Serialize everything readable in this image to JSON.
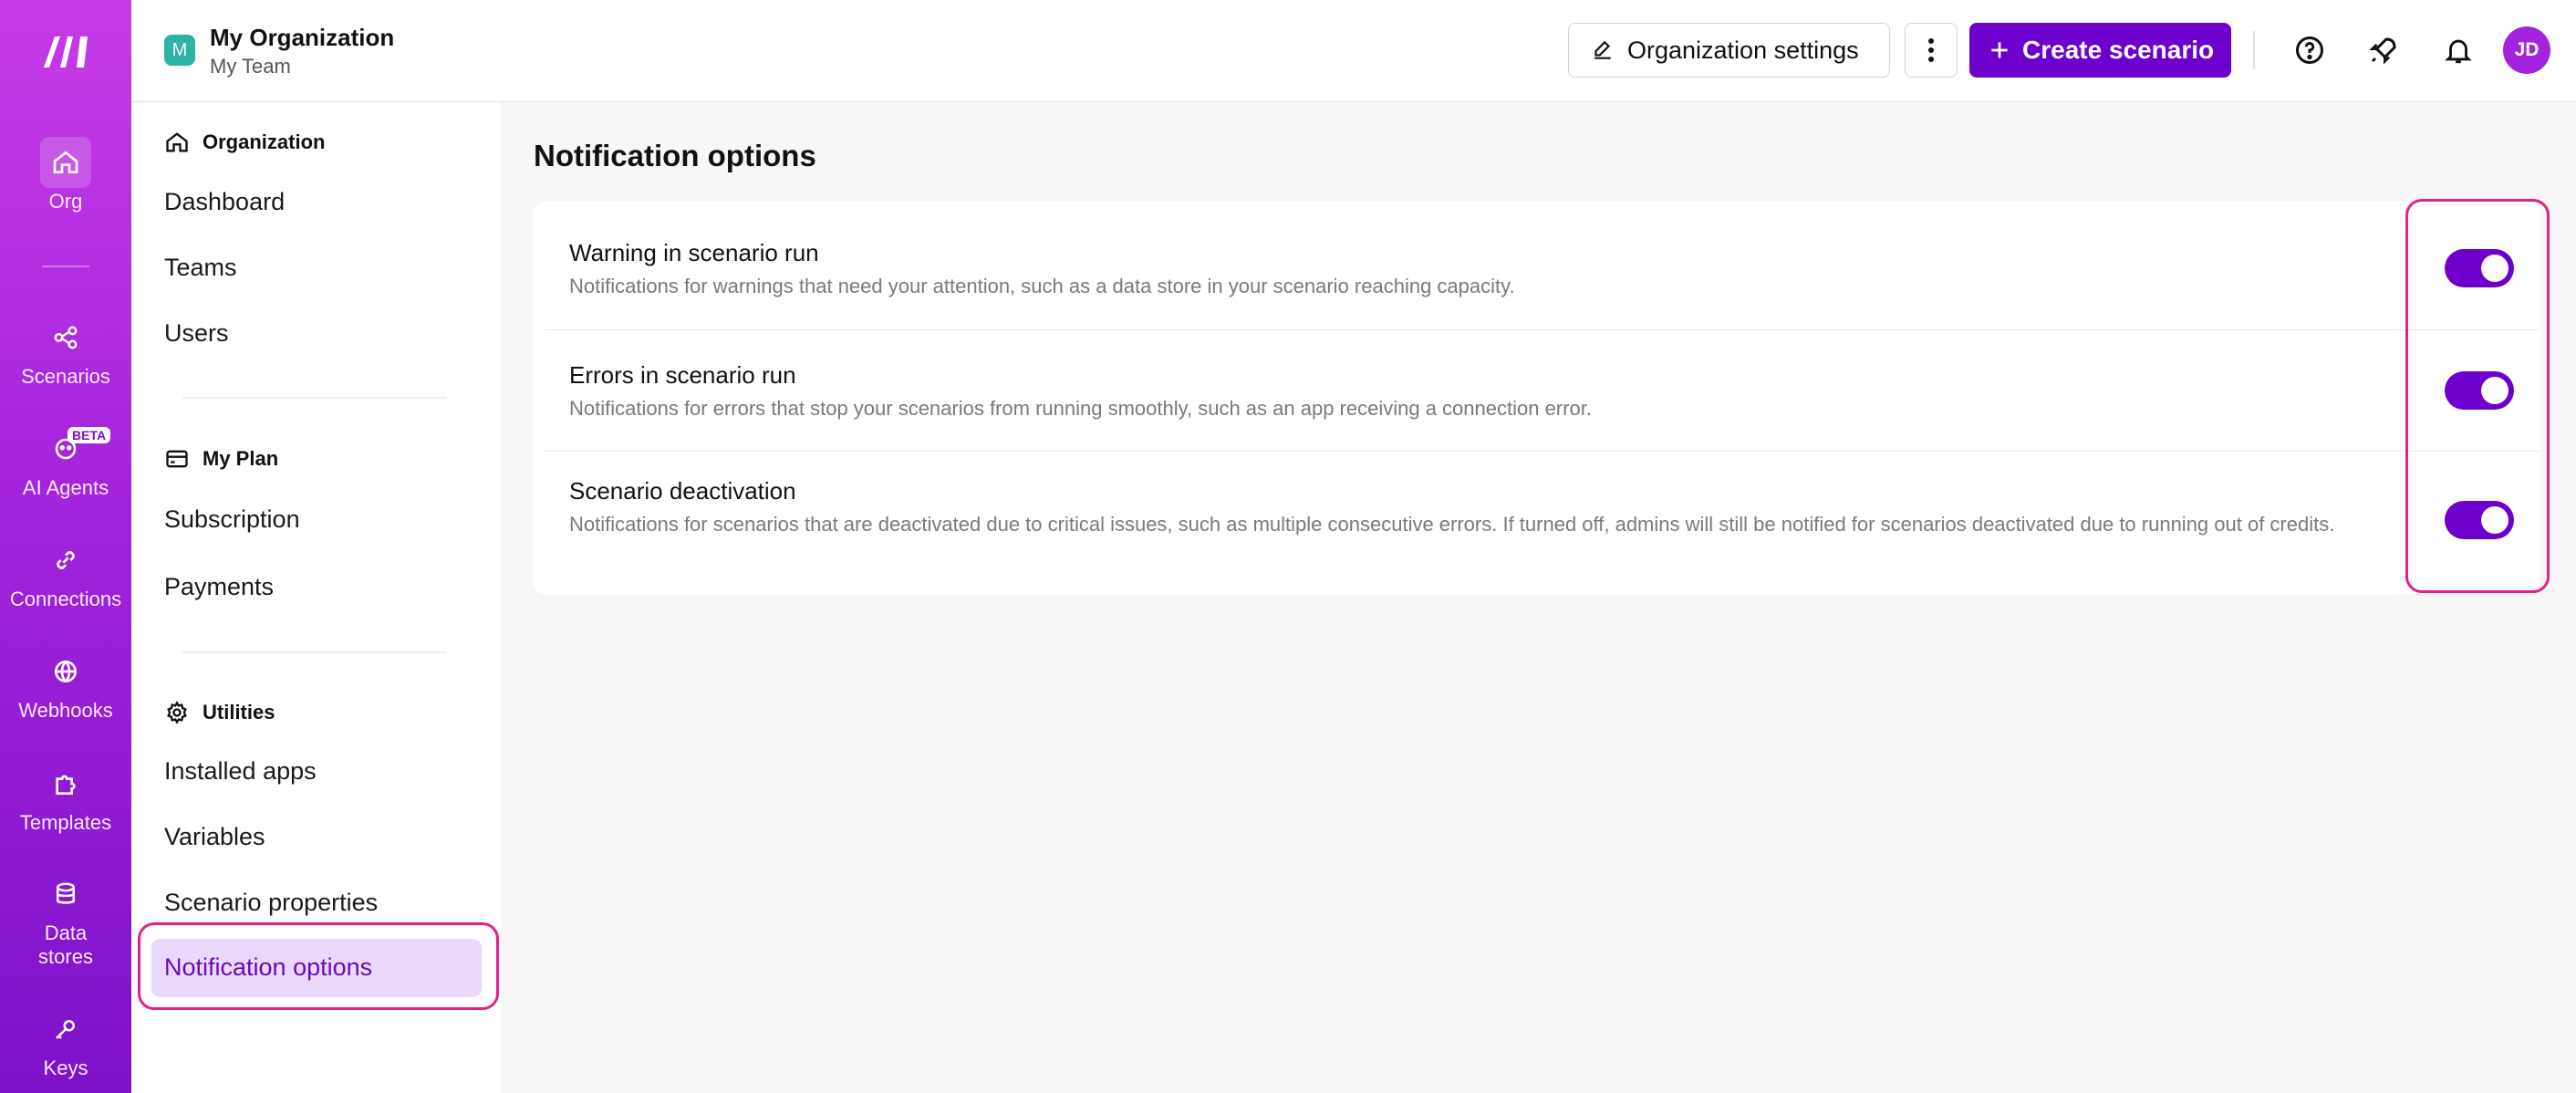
{
  "rail": {
    "items": [
      {
        "label": "Org",
        "icon": "home-icon"
      },
      {
        "label": "Scenarios",
        "icon": "share-nodes-icon"
      },
      {
        "label": "AI Agents",
        "icon": "ai-agent-icon",
        "badge": "BETA"
      },
      {
        "label": "Connections",
        "icon": "link-icon"
      },
      {
        "label": "Webhooks",
        "icon": "globe-icon"
      },
      {
        "label": "Templates",
        "icon": "puzzle-icon"
      },
      {
        "label": "Data stores",
        "icon": "database-icon"
      },
      {
        "label": "Keys",
        "icon": "key-icon"
      }
    ]
  },
  "header": {
    "org_initial": "M",
    "org_name": "My Organization",
    "team_name": "My Team",
    "settings_label": "Organization settings",
    "create_label": "Create scenario",
    "user_initials": "JD"
  },
  "subnav": {
    "organization": {
      "heading": "Organization",
      "items": [
        "Dashboard",
        "Teams",
        "Users"
      ]
    },
    "plan": {
      "heading": "My Plan",
      "items": [
        "Subscription",
        "Payments"
      ]
    },
    "utilities": {
      "heading": "Utilities",
      "items": [
        "Installed apps",
        "Variables",
        "Scenario properties",
        "Notification options"
      ]
    }
  },
  "main": {
    "title": "Notification options",
    "rows": [
      {
        "title": "Warning in scenario run",
        "desc": "Notifications for warnings that need your attention, such as a data store in your scenario reaching capacity.",
        "enabled": true
      },
      {
        "title": "Errors in scenario run",
        "desc": "Notifications for errors that stop your scenarios from running smoothly, such as an app receiving a connection error.",
        "enabled": true
      },
      {
        "title": "Scenario deactivation",
        "desc": "Notifications for scenarios that are deactivated due to critical issues, such as multiple consecutive errors. If turned off, admins will still be notified for scenarios deactivated due to running out of credits.",
        "enabled": true
      }
    ]
  },
  "colors": {
    "accent": "#6d00cc",
    "highlight": "#e0218a",
    "rail_top": "#c73be6",
    "rail_bottom": "#7d12c9"
  }
}
